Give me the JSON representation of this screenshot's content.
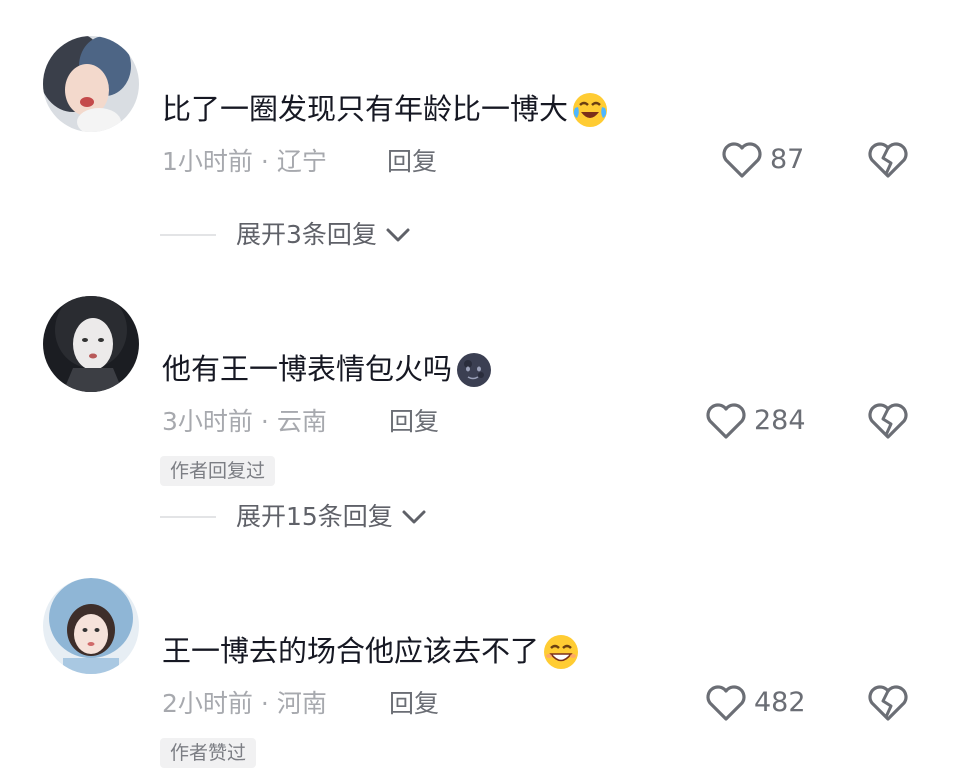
{
  "comments": [
    {
      "text": "比了一圈发现只有年龄比一博大",
      "emoji": "crying-laughing-emoji",
      "time": "1小时前",
      "location": "辽宁",
      "reply_label": "回复",
      "likes": "87",
      "badge": "",
      "expand_label": "展开3条回复"
    },
    {
      "text": "他有王一博表情包火吗",
      "emoji": "dark-moon-face-emoji",
      "time": "3小时前",
      "location": "云南",
      "reply_label": "回复",
      "likes": "284",
      "badge": "作者回复过",
      "expand_label": "展开15条回复"
    },
    {
      "text": "王一博去的场合他应该去不了",
      "emoji": "grinning-sweat-emoji",
      "time": "2小时前",
      "location": "河南",
      "reply_label": "回复",
      "likes": "482",
      "badge": "作者赞过",
      "expand_label": ""
    }
  ],
  "separator": "·",
  "colors": {
    "text": "#161823",
    "meta": "#a7a9ae",
    "icon": "#6b6e75",
    "badge_bg": "#f1f1f2"
  },
  "icons": {
    "like": "heart-outline-icon",
    "dislike": "broken-heart-icon",
    "expand": "chevron-down-icon"
  }
}
